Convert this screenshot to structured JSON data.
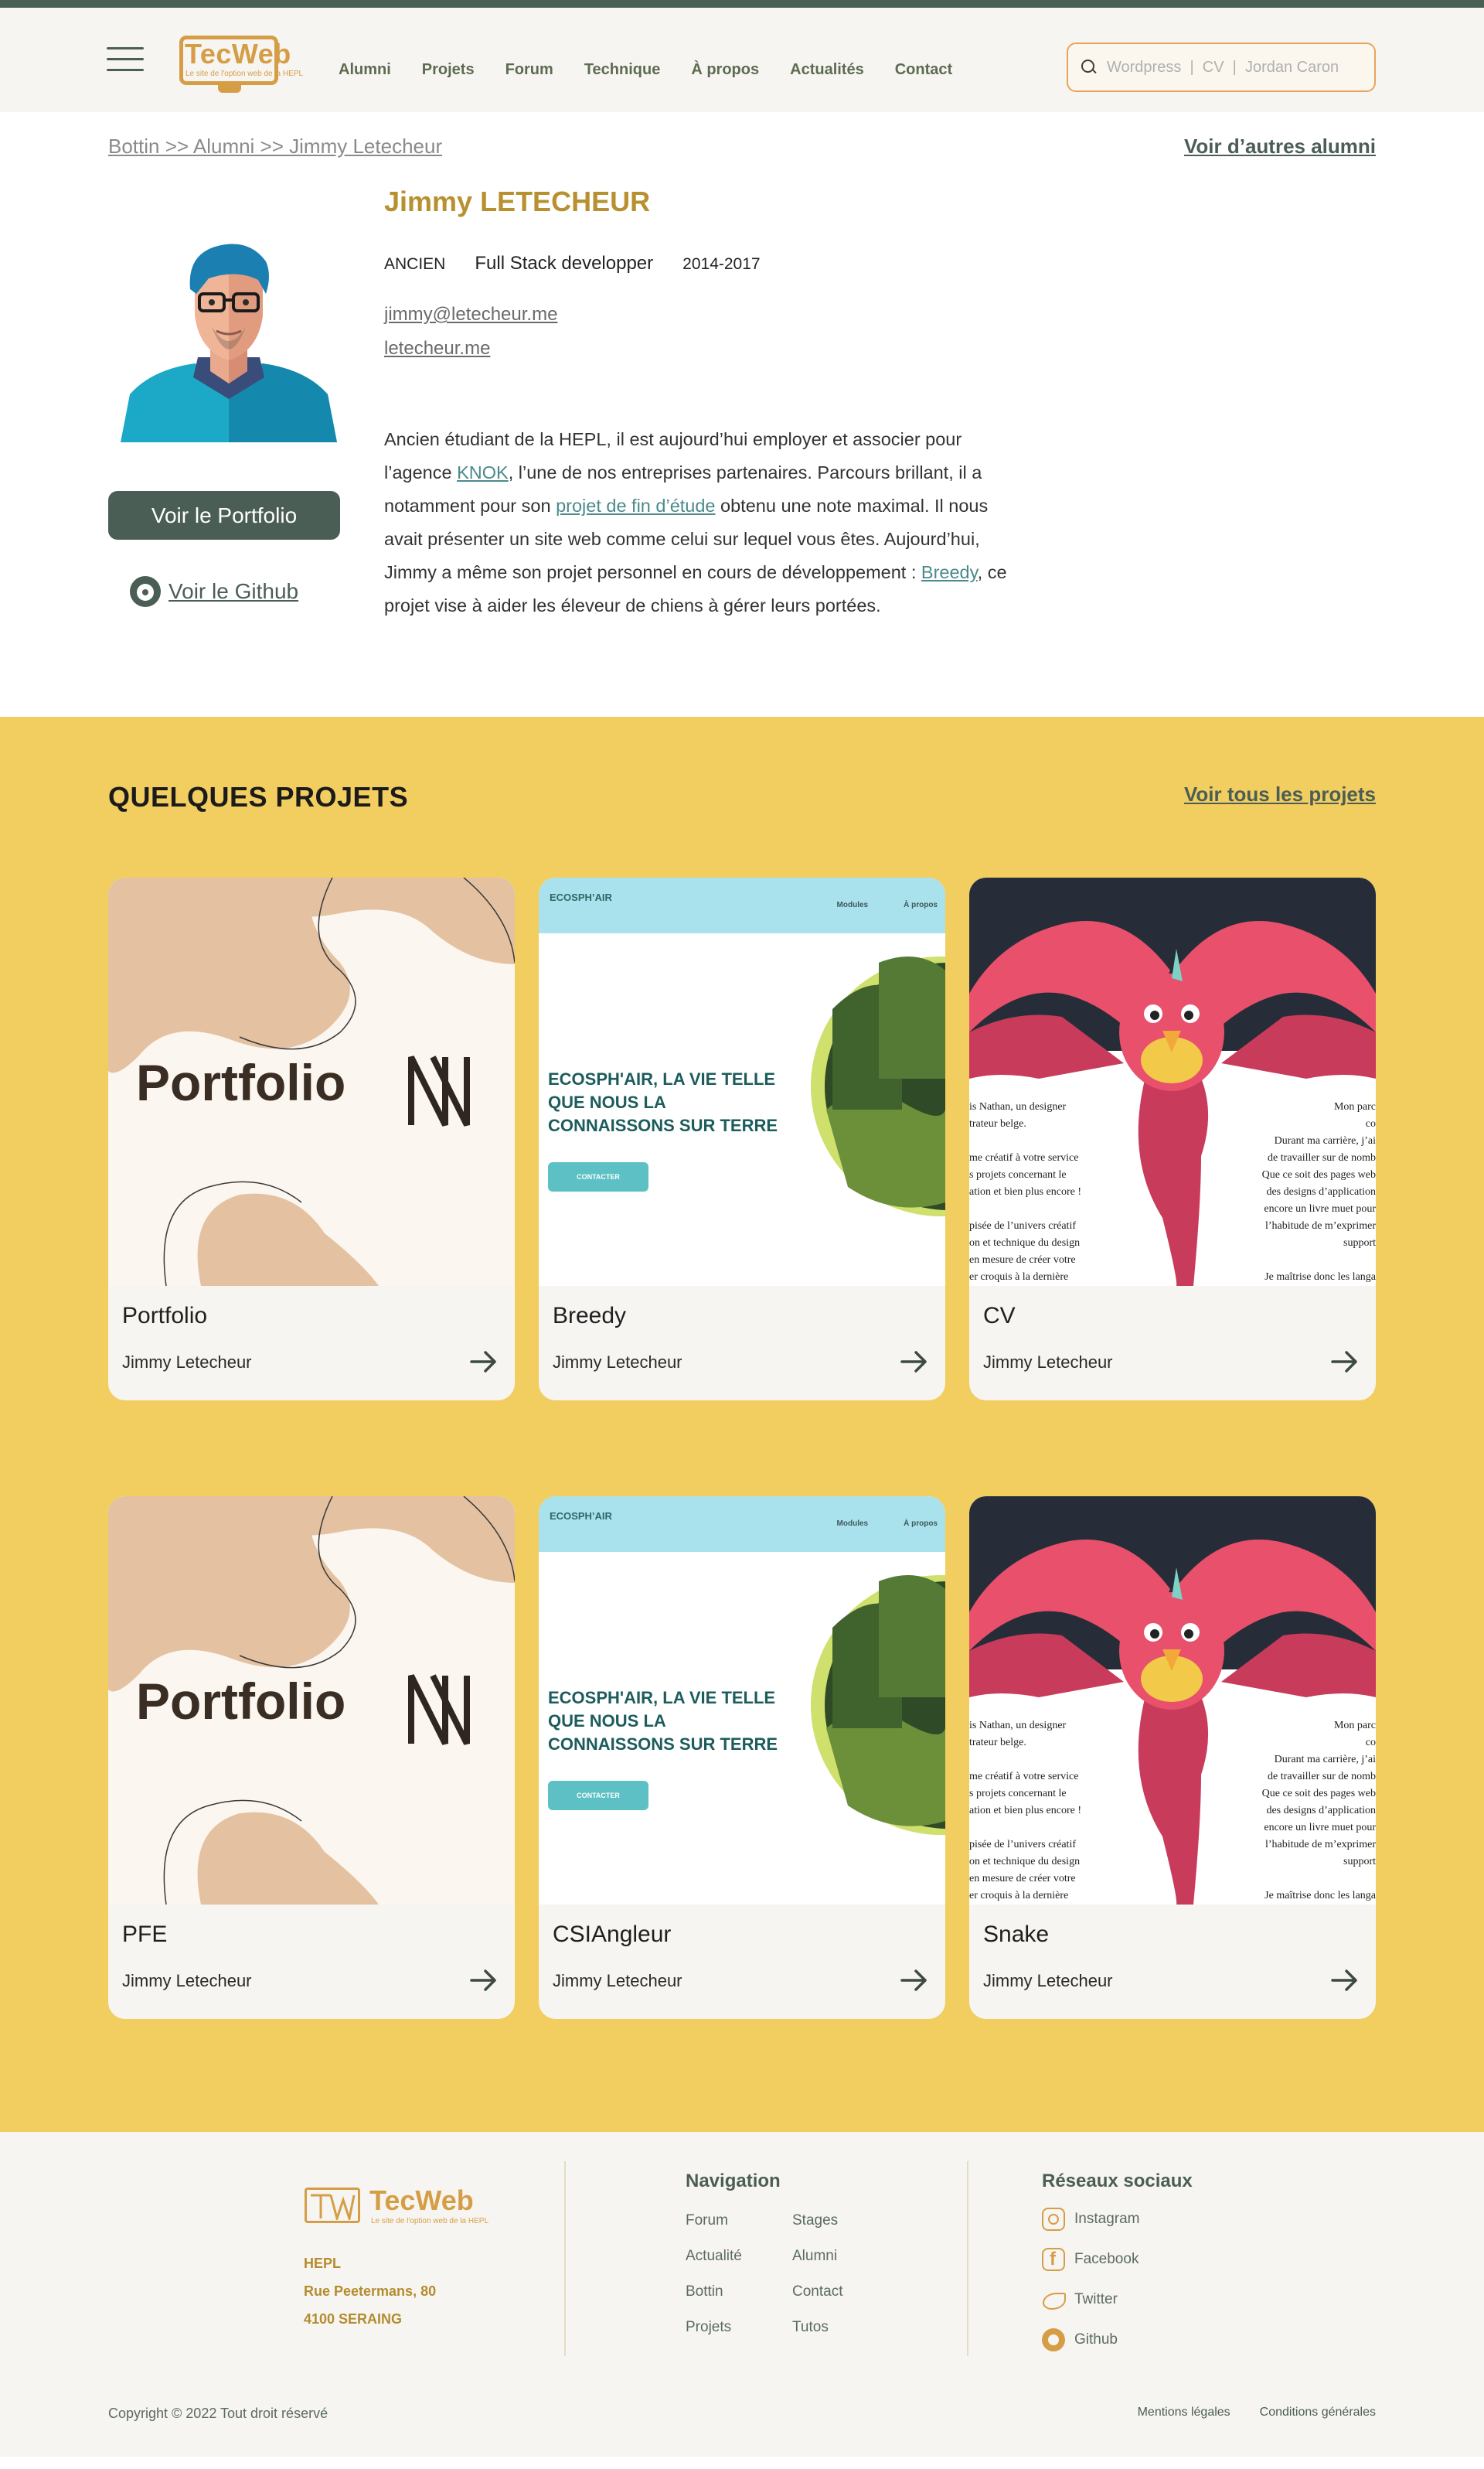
{
  "header": {
    "logo_title": "TecWeb",
    "logo_subtitle": "Le site de l'option web de la HEPL",
    "nav": [
      "Alumni",
      "Projets",
      "Forum",
      "Technique",
      "À propos",
      "Actualités",
      "Contact"
    ],
    "search_placeholder": "Wordpress  |  CV  |  Jordan Caron"
  },
  "breadcrumb": "Bottin >> Alumni >> Jimmy Letecheur",
  "other_alumni_link": "Voir d’autres alumni",
  "profile": {
    "name": "Jimmy LETECHEUR",
    "status": "ANCIEN",
    "job": "Full Stack developper",
    "years": "2014-2017",
    "email": "jimmy@letecheur.me",
    "website": "letecheur.me",
    "bio": {
      "part1": "Ancien étudiant de la HEPL, il est aujourd’hui employer et associer pour l’agence ",
      "link1": "KNOK",
      "part2": ", l’une de nos entreprises partenaires. Parcours brillant, il a notamment pour son ",
      "link2": "projet de fin d’étude",
      "part3": " obtenu une note maximal. Il nous avait présenter un site web comme celui sur lequel vous êtes. Aujourd’hui, Jimmy a même son projet personnel en cours de développement : ",
      "link3": "Breedy",
      "part4": ", ce projet vise à aider les éleveur de chiens à gérer leurs portées."
    },
    "portfolio_button": "Voir le Portfolio",
    "github_link": "Voir le Github"
  },
  "projects": {
    "title": "QUELQUES PROJETS",
    "see_all": "Voir tous les projets",
    "cards": [
      {
        "title": "Portfolio",
        "author": "Jimmy Letecheur",
        "thumb": "portfolio"
      },
      {
        "title": "Breedy",
        "author": "Jimmy Letecheur",
        "thumb": "ecosphair"
      },
      {
        "title": "CV",
        "author": "Jimmy Letecheur",
        "thumb": "cv"
      },
      {
        "title": "PFE",
        "author": "Jimmy Letecheur",
        "thumb": "portfolio"
      },
      {
        "title": "CSIAngleur",
        "author": "Jimmy Letecheur",
        "thumb": "ecosphair"
      },
      {
        "title": "Snake",
        "author": "Jimmy Letecheur",
        "thumb": "cv"
      }
    ],
    "thumb_text": {
      "portfolio_word": "Portfolio",
      "eco_logo": "ECOSPH’AIR",
      "eco_menu": [
        "Modules",
        "À propos"
      ],
      "eco_headline": "ECOSPH'AIR, LA VIE TELLE QUE NOUS LA CONNAISSONS SUR TERRE",
      "eco_button": "CONTACTER",
      "cv_left": [
        "is Nathan, un designer",
        "trateur belge.",
        "",
        "me créatif à votre service",
        "s projets concernant le",
        "ation et bien plus encore !",
        "",
        "pisée de l’univers créatif",
        "on et technique du design",
        "en mesure de créer votre",
        "er croquis à la dernière",
        "."
      ],
      "cv_right": [
        "Mon parc",
        "co",
        "Durant ma carrière, j’ai",
        "de travailler sur de nomb",
        "Que ce soit des pages web",
        "des designs d’application",
        "encore un livre muet pour",
        "l’habitude de m’exprimer",
        "support",
        "",
        "Je maîtrise donc les langa"
      ]
    }
  },
  "footer": {
    "logo_title": "TecWeb",
    "logo_subtitle": "Le site de l'option web de la HEPL",
    "address": [
      "HEPL",
      "Rue Peetermans, 80",
      "4100 SERAING"
    ],
    "nav_title": "Navigation",
    "nav_links": [
      "Forum",
      "Stages",
      "Actualité",
      "Alumni",
      "Bottin",
      "Contact",
      "Projets",
      "Tutos"
    ],
    "social_title": "Réseaux sociaux",
    "social": [
      {
        "label": "Instagram",
        "icon": "instagram-icon"
      },
      {
        "label": "Facebook",
        "icon": "facebook-icon"
      },
      {
        "label": "Twitter",
        "icon": "twitter-icon"
      },
      {
        "label": "Github",
        "icon": "github-icon"
      }
    ],
    "copyright": "Copyright © 2022 Tout droit réservé",
    "legal": [
      "Mentions légales",
      "Conditions générales"
    ]
  },
  "colors": {
    "topbar": "#4b5e55",
    "accent_gold": "#d59e46",
    "name_gold": "#b7902f",
    "projects_bg": "#f2cd5f",
    "primary_green": "#4b5e55"
  }
}
